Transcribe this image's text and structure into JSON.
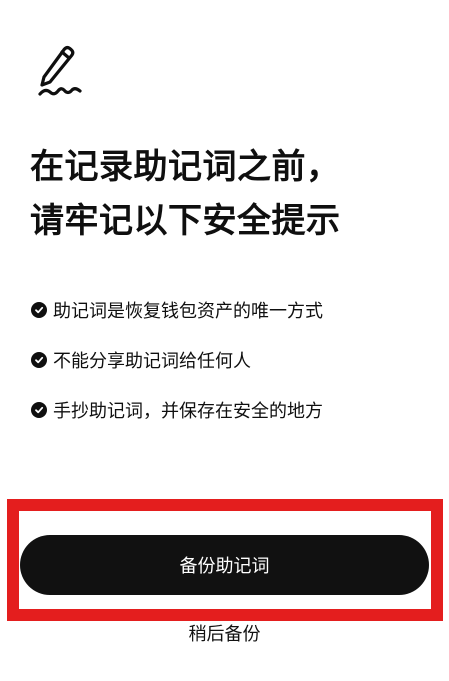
{
  "header": {
    "icon": "pen-signature-icon",
    "title_line1": "在记录助记词之前，",
    "title_line2": "请牢记以下安全提示"
  },
  "tips": [
    {
      "icon": "check-circle-icon",
      "text": "助记词是恢复钱包资产的唯一方式"
    },
    {
      "icon": "check-circle-icon",
      "text": "不能分享助记词给任何人"
    },
    {
      "icon": "check-circle-icon",
      "text": "手抄助记词，并保存在安全的地方"
    }
  ],
  "actions": {
    "backup_label": "备份助记词",
    "later_label": "稍后备份"
  },
  "colors": {
    "text": "#0f0f0f",
    "button_bg": "#111111",
    "button_text": "#ffffff",
    "highlight_border": "#e41e1e"
  }
}
